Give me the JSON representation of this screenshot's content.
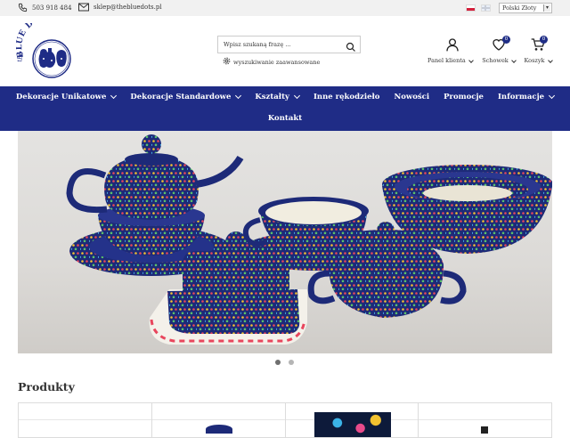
{
  "topbar": {
    "phone": "503 918 484",
    "email": "sklep@thebluedots.pl",
    "languages": [
      "pl",
      "en"
    ],
    "currency": "Polski Złoty"
  },
  "logo": {
    "text": "the BLUE DOTS"
  },
  "search": {
    "placeholder": "Wpisz szukaną frazę ...",
    "advanced_label": "wyszukiwanie zaawansowane"
  },
  "header_actions": [
    {
      "name": "account",
      "label": "Panel klienta",
      "icon": "user-icon"
    },
    {
      "name": "wishlist",
      "label": "Schowek",
      "icon": "heart-icon",
      "count": "0"
    },
    {
      "name": "cart",
      "label": "Koszyk",
      "icon": "cart-icon",
      "count": "0"
    }
  ],
  "nav": {
    "items": [
      {
        "label": "Dekoracje Unikatowe",
        "dropdown": true
      },
      {
        "label": "Dekoracje Standardowe",
        "dropdown": true
      },
      {
        "label": "Kształty",
        "dropdown": true
      },
      {
        "label": "Inne rękodzieło",
        "dropdown": false
      },
      {
        "label": "Nowości",
        "dropdown": false
      },
      {
        "label": "Promocje",
        "dropdown": false
      },
      {
        "label": "Informacje",
        "dropdown": true
      }
    ],
    "items_row2": [
      {
        "label": "Kontakt",
        "dropdown": false
      }
    ]
  },
  "slider": {
    "slides": 2,
    "active": 1
  },
  "products": {
    "title": "Produkty"
  },
  "colors": {
    "brand": "#1f2c86",
    "topbar_bg": "#f1f1f1"
  }
}
